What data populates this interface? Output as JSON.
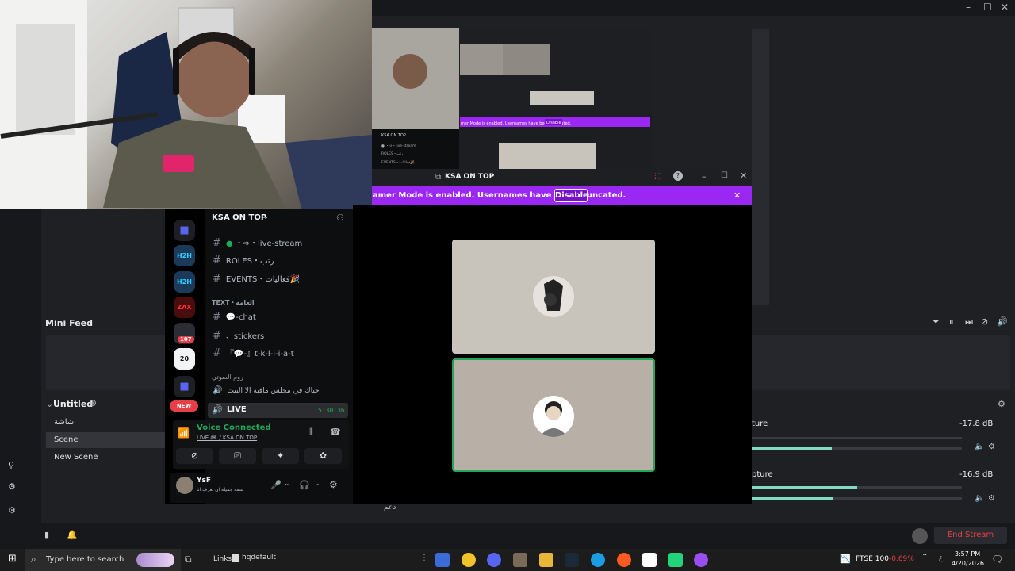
{
  "discord": {
    "server_name": "KSA ON TOP",
    "window_title": "KSA ON TOP",
    "streamer_banner": "amer Mode is enabled. Usernames have been truncated.",
    "disable_button": "Disable",
    "channels": [
      {
        "label": "・➩・live-stream"
      },
      {
        "label": "ROLES・رتب"
      },
      {
        "label": "EVENTS・فعاليات🎉"
      }
    ],
    "text_category": "TEXT・العامه",
    "text_channels": [
      {
        "label": "💬-chat"
      },
      {
        "label": "、stickers"
      },
      {
        "label": "『💬-』t-k-l-i-i-a-t"
      }
    ],
    "voice_category": "روم الصوتي",
    "voice_channel": "حياك في مجلس مافيه الا البيت",
    "live_label": "LIVE",
    "live_timer": "5:30:36",
    "voice_connected": "Voice Connected",
    "voice_path": "LIVE 🎮 / KSA ON TOP",
    "user_name": "YsF",
    "user_status": "سمة جميلة ان تعرف انا",
    "guild_badges": {
      "mention_count": "107",
      "new_badge": "NEW",
      "guild_20": "20"
    }
  },
  "obs": {
    "mini_feed": "Mini Feed",
    "scenes_title": "Untitled",
    "scenes": [
      "شاشة",
      "Scene",
      "New Scene"
    ],
    "audio": [
      {
        "name": "ture",
        "db": "-17.8 dB",
        "level": 0.38
      },
      {
        "name": "pture",
        "db": "-16.9 dB",
        "level": 0.39
      }
    ],
    "end_stream": "End Stream",
    "bottom_text": "دعم"
  },
  "nested": {
    "server": "KSA ON TOP",
    "banner": "mer Mode is enabled. Usernames have been truncated.",
    "disable": "Disable",
    "ch1": "・➩・live-stream",
    "ch2": "ROLES・رتب",
    "ch3": "EVENTS・فعاليات🎉"
  },
  "taskbar": {
    "search_placeholder": "Type here to search",
    "links": "Links",
    "hqdefault": "hqdefault",
    "ftse_label": "FTSE 100",
    "ftse_value": "-0,69%",
    "time": "3:57 PM",
    "date": "4/20/2026",
    "lang": "ع"
  },
  "colors": {
    "accent_purple": "#9b27f2",
    "live_green": "#23a55a",
    "end_stream": "#e64047"
  }
}
